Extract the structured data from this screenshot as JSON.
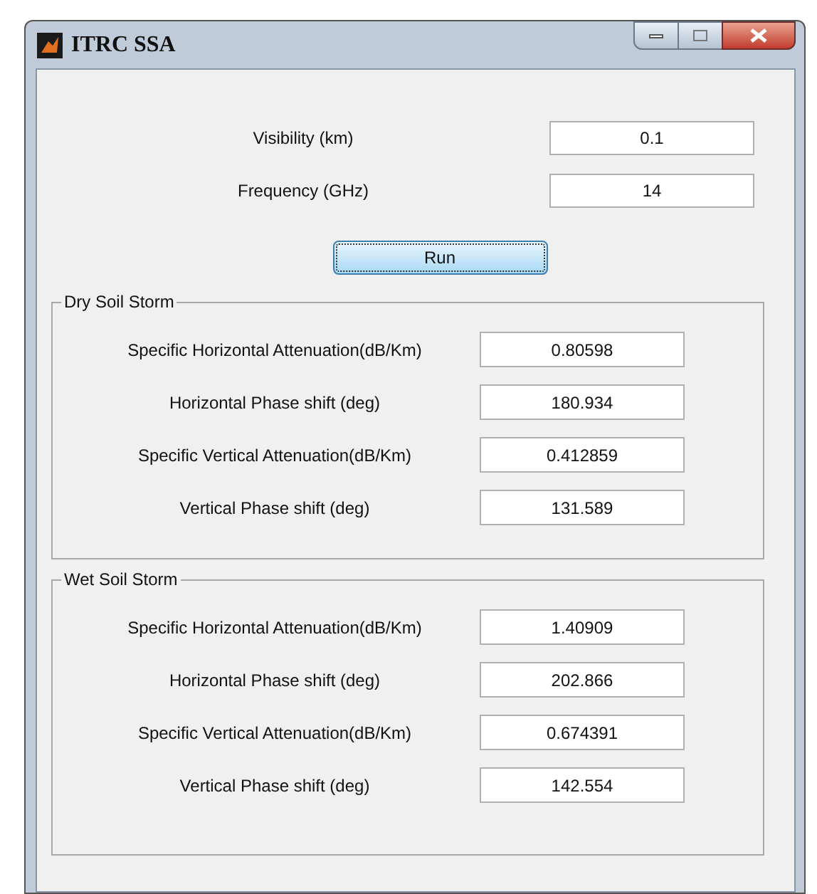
{
  "window": {
    "title": "ITRC SSA"
  },
  "inputs": [
    {
      "label": "Visibility (km)",
      "value": "0.1"
    },
    {
      "label": "Frequency (GHz)",
      "value": "14"
    }
  ],
  "run_button": {
    "label": "Run"
  },
  "panels": [
    {
      "title": "Dry Soil Storm",
      "rows": [
        {
          "label": "Specific Horizontal Attenuation(dB/Km)",
          "value": "0.80598"
        },
        {
          "label": "Horizontal Phase shift (deg)",
          "value": "180.934"
        },
        {
          "label": "Specific Vertical Attenuation(dB/Km)",
          "value": "0.412859"
        },
        {
          "label": "Vertical Phase shift (deg)",
          "value": "131.589"
        }
      ]
    },
    {
      "title": "Wet Soil Storm",
      "rows": [
        {
          "label": "Specific Horizontal Attenuation(dB/Km)",
          "value": "1.40909"
        },
        {
          "label": "Horizontal Phase shift (deg)",
          "value": "202.866"
        },
        {
          "label": "Specific Vertical Attenuation(dB/Km)",
          "value": "0.674391"
        },
        {
          "label": "Vertical Phase shift (deg)",
          "value": "142.554"
        }
      ]
    }
  ]
}
